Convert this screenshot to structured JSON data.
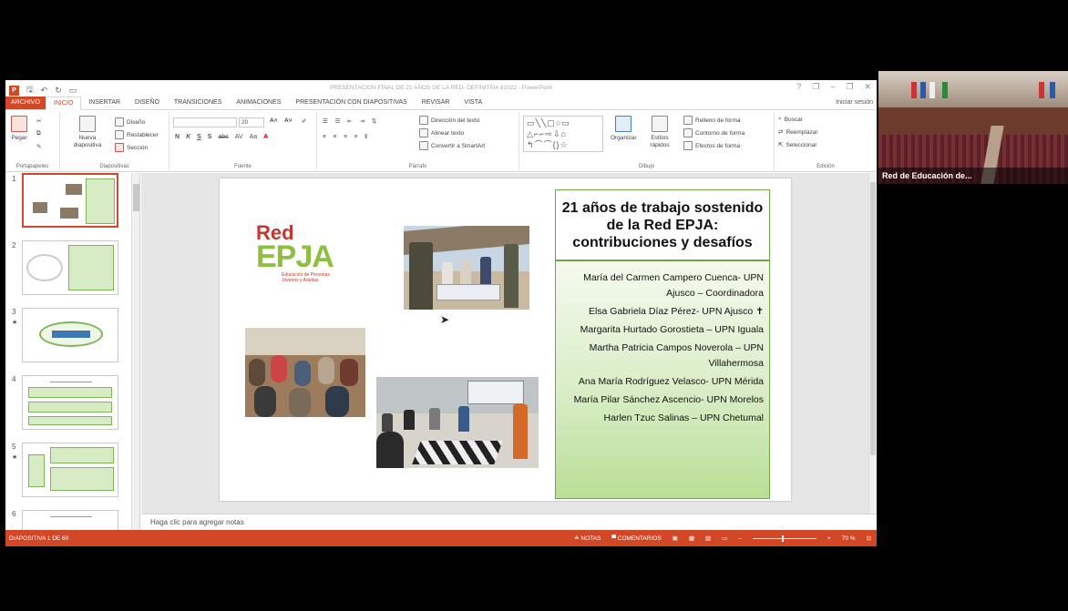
{
  "window": {
    "title": "PRESENTACION FINAL DE 21 AÑOS DE LA RED- DEFINITIVA 81022 - PowerPoint",
    "help": "?",
    "min": "–",
    "restore": "❐",
    "close": "✕"
  },
  "tabs": [
    {
      "label": "ARCHIVO"
    },
    {
      "label": "INICIO"
    },
    {
      "label": "INSERTAR"
    },
    {
      "label": "DISEÑO"
    },
    {
      "label": "TRANSICIONES"
    },
    {
      "label": "ANIMACIONES"
    },
    {
      "label": "PRESENTACIÓN CON DIAPOSITIVAS"
    },
    {
      "label": "REVISAR"
    },
    {
      "label": "VISTA"
    }
  ],
  "signin": "Iniciar sesión",
  "ribbon": {
    "portapapeles": {
      "label": "Portapapeles",
      "paste": "Pegar"
    },
    "diapositivas": {
      "label": "Diapositivas",
      "new_slide": "Nueva diapositiva",
      "design": "Diseño",
      "reset": "Restablecer",
      "section": "Sección"
    },
    "fuente": {
      "label": "Fuente",
      "size": "20",
      "fmt": [
        "N",
        "K",
        "S",
        "S",
        "abc",
        "AV",
        "Aa",
        "A"
      ]
    },
    "parrafo": {
      "label": "Párrafo",
      "text_dir": "Dirección del texto",
      "align_text": "Alinear texto",
      "smartart": "Convertir a SmartArt"
    },
    "dibujo": {
      "label": "Dibujo",
      "organize": "Organizar",
      "quick_styles": "Estilos rápidos",
      "fill": "Relleno de forma",
      "outline": "Contorno de forma",
      "effects": "Efectos de forma"
    },
    "edicion": {
      "label": "Edición",
      "find": "Buscar",
      "replace": "Reemplazar",
      "select": "Seleccionar"
    }
  },
  "thumbnails": [
    {
      "num": "1",
      "star": ""
    },
    {
      "num": "2",
      "star": ""
    },
    {
      "num": "3",
      "star": "★"
    },
    {
      "num": "4",
      "star": ""
    },
    {
      "num": "5",
      "star": "★"
    },
    {
      "num": "6",
      "star": ""
    }
  ],
  "slide": {
    "logo_red": "Red",
    "logo_epja": "EPJA",
    "logo_sub": "Educación de Personas Jóvenes y Adultas",
    "title": "21 años de trabajo sostenido de la Red EPJA: contribuciones y desafíos",
    "authors": [
      "María del Carmen Campero Cuenca- UPN Ajusco – Coordinadora",
      "Elsa Gabriela Díaz Pérez- UPN Ajusco ✝",
      "Margarita Hurtado Gorostieta – UPN Iguala",
      "Martha Patricia Campos Noverola – UPN Villahermosa",
      "Ana María Rodríguez Velasco- UPN Mérida",
      "María Pilar Sánchez Ascencio- UPN Morelos",
      "Harlen Tzuc Salinas – UPN Chetumal"
    ]
  },
  "notes_placeholder": "Haga clic para agregar notas",
  "status": {
    "slide_info": "DIAPOSITIVA 1 DE 60",
    "notes": "NOTAS",
    "comments": "COMENTARIOS",
    "zoom": "70 %"
  },
  "video": {
    "caption": "Red de Educación de..."
  }
}
